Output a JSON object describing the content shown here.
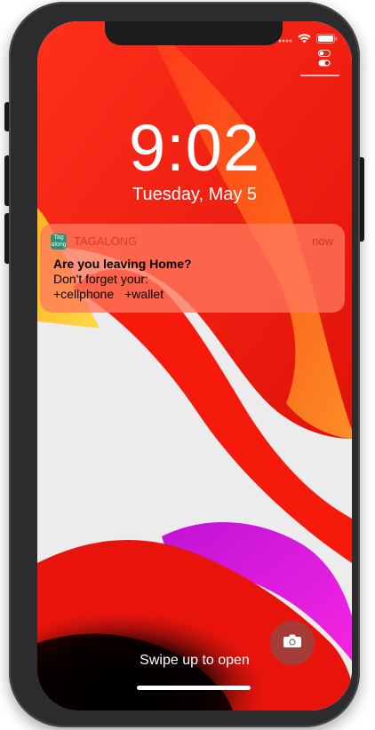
{
  "lock_screen": {
    "time": "9:02",
    "date": "Tuesday, May 5",
    "swipe_hint": "Swipe up to open"
  },
  "notification": {
    "app_icon_text": "Tag along",
    "app_name": "TAGALONG",
    "time": "now",
    "title": "Are you leaving Home?",
    "body": "Don't forget your:",
    "items": [
      "+cellphone",
      "+wallet"
    ]
  },
  "icons": {
    "status": [
      "signal-dots-icon",
      "wifi-icon",
      "battery-icon"
    ],
    "control_center": "control-center-toggle-icon",
    "camera": "camera-icon"
  },
  "colors": {
    "wallpaper_red": "#ff2a12",
    "wallpaper_orange": "#ff8a1e",
    "wallpaper_magenta": "#e21bd8",
    "wallpaper_light": "#ececec",
    "notification_bg": "#ff785c",
    "app_name": "#d63a2c",
    "app_icon": "#2f8f73",
    "phone_frame": "#2c2c2e"
  }
}
